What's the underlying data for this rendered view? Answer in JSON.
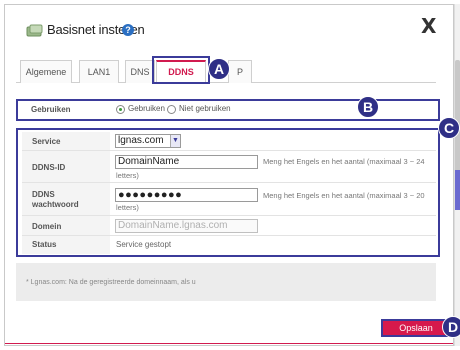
{
  "dialog": {
    "title": "Basisnet instellen",
    "help_glyph": "?",
    "close_label": "X"
  },
  "tabs": [
    {
      "label": "Algemene",
      "active": false
    },
    {
      "label": "LAN1",
      "active": false
    },
    {
      "label": "DNS",
      "active": false
    },
    {
      "label": "DDNS",
      "active": true
    },
    {
      "label": "P",
      "active": false
    }
  ],
  "annotations": {
    "a": "A",
    "b": "B",
    "c": "C",
    "d": "D"
  },
  "use": {
    "label": "Gebruiken",
    "option_on": "Gebruiken",
    "option_off": "Niet gebruiken",
    "selected": "Gebruiken"
  },
  "form": {
    "service": {
      "label": "Service",
      "value": "lgnas.com"
    },
    "ddns_id": {
      "label": "DDNS-ID",
      "value": "DomainName",
      "hint_line1": "Meng het Engels en het aantal (maximaal 3 ~ 24",
      "hint_line2": "letters)"
    },
    "ddns_pw": {
      "label_line1": "DDNS",
      "label_line2": "wachtwoord",
      "value": "●●●●●●●●●",
      "hint_line1": "Meng het Engels en het aantal (maximaal 3 ~ 20",
      "hint_line2": "letters)"
    },
    "domain": {
      "label": "Domein",
      "value": "DomainName.lgnas.com"
    },
    "status": {
      "label": "Status",
      "value": "Service gestopt"
    }
  },
  "notice": "* Lgnas.com: Na de geregistreerde domeinnaam, als u",
  "save_label": "Opslaan",
  "colors": {
    "accent": "#d6194c",
    "annotation": "#3b3b9a"
  }
}
